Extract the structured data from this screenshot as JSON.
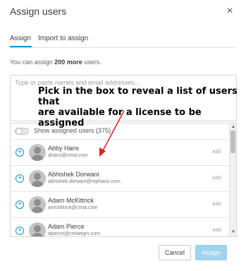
{
  "dialog": {
    "title": "Assign users",
    "close_icon": "close-icon",
    "close_glyph": "×"
  },
  "tabs": [
    {
      "label": "Assign",
      "active": true
    },
    {
      "label": "Import to assign",
      "active": false
    }
  ],
  "availability": {
    "prefix": "You can assign ",
    "count": "200 more",
    "suffix": " users."
  },
  "search": {
    "placeholder": "Type or paste names and email addresses...",
    "value": ""
  },
  "annotation": {
    "line1": "Pick in the box to reveal a list of users that",
    "line2": "are available for a  license to be assigned",
    "color": "#000000",
    "arrow_color": "#e02020"
  },
  "list": {
    "toggle_label": "Show assigned users (375)",
    "toggle_on": false,
    "users": [
      {
        "name": "Abby Hans",
        "email": "ahans@cmta.com",
        "action": "Add"
      },
      {
        "name": "Abhishek Dorwani",
        "email": "abhishek.dorwani@mphasis.com",
        "action": "Add"
      },
      {
        "name": "Adam McKittrick",
        "email": "amckittrick@cmta.com",
        "action": "Add"
      },
      {
        "name": "Adam Pierce",
        "email": "apierce@cmtaegrs.com",
        "action": "Add"
      }
    ],
    "add_glyph": "+",
    "scroll_up_glyph": "▲",
    "scroll_down_glyph": "▼"
  },
  "footer": {
    "cancel_label": "Cancel",
    "assign_label": "Assign"
  },
  "colors": {
    "accent": "#0696d7",
    "assign_disabled": "#9fd3ee",
    "annotation_arrow": "#e02020"
  }
}
